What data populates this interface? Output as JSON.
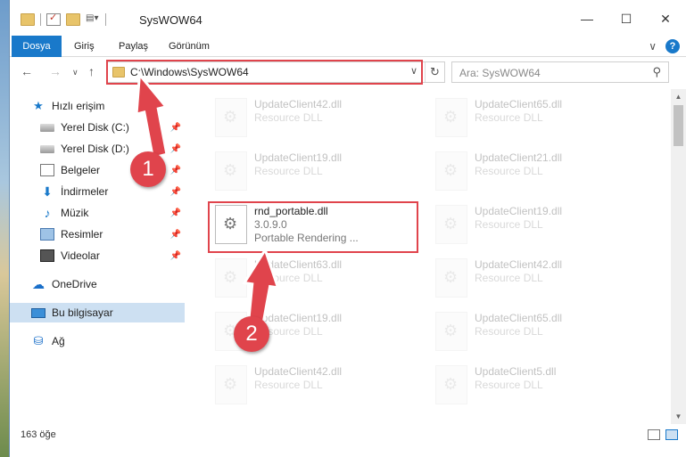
{
  "window": {
    "title": "SysWOW64",
    "minimize_icon": "—",
    "maximize_icon": "☐",
    "close_icon": "✕"
  },
  "ribbon": {
    "tabs": [
      "Dosya",
      "Giriş",
      "Paylaş",
      "Görünüm"
    ],
    "file_tab_color": "#1979ca",
    "collapse_icon": "∨",
    "help_icon": "?"
  },
  "navigation": {
    "back_icon": "←",
    "forward_icon": "→",
    "recent_icon": "∨",
    "up_icon": "↑",
    "address": "C:\\Windows\\SysWOW64",
    "address_dropdown_icon": "∨",
    "refresh_icon": "↻",
    "search_placeholder": "Ara: SysWOW64",
    "search_icon": "⚲"
  },
  "sidebar": {
    "items": [
      {
        "label": "Hızlı erişim",
        "icon": "star-icon",
        "pinned": false
      },
      {
        "label": "Yerel Disk (C:)",
        "icon": "drive-icon",
        "pinned": true
      },
      {
        "label": "Yerel Disk (D:)",
        "icon": "drive-icon",
        "pinned": true
      },
      {
        "label": "Belgeler",
        "icon": "documents-icon",
        "pinned": true
      },
      {
        "label": "İndirmeler",
        "icon": "downloads-icon",
        "pinned": true
      },
      {
        "label": "Müzik",
        "icon": "music-icon",
        "pinned": true
      },
      {
        "label": "Resimler",
        "icon": "pictures-icon",
        "pinned": true
      },
      {
        "label": "Videolar",
        "icon": "videos-icon",
        "pinned": true
      },
      {
        "label": "OneDrive",
        "icon": "onedrive-icon",
        "pinned": false
      },
      {
        "label": "Bu bilgisayar",
        "icon": "this-pc-icon",
        "pinned": false,
        "selected": true
      },
      {
        "label": "Ağ",
        "icon": "network-icon",
        "pinned": false
      }
    ],
    "pin_icon": "📌"
  },
  "files": [
    {
      "name": "UpdateClient42.dll",
      "line2": "Resource DLL",
      "line3": "",
      "faded": true
    },
    {
      "name": "UpdateClient65.dll",
      "line2": "Resource DLL",
      "line3": "",
      "faded": true
    },
    {
      "name": "UpdateClient19.dll",
      "line2": "Resource DLL",
      "line3": "",
      "faded": true
    },
    {
      "name": "UpdateClient21.dll",
      "line2": "Resource DLL",
      "line3": "",
      "faded": true
    },
    {
      "name": "rnd_portable.dll",
      "line2": "3.0.9.0",
      "line3": "Portable Rendering ...",
      "faded": false
    },
    {
      "name": "UpdateClient19.dll",
      "line2": "Resource DLL",
      "line3": "",
      "faded": true
    },
    {
      "name": "UpdateClient63.dll",
      "line2": "Resource DLL",
      "line3": "",
      "faded": true
    },
    {
      "name": "UpdateClient42.dll",
      "line2": "Resource DLL",
      "line3": "",
      "faded": true
    },
    {
      "name": "UpdateClient19.dll",
      "line2": "Resource DLL",
      "line3": "",
      "faded": true
    },
    {
      "name": "UpdateClient65.dll",
      "line2": "Resource DLL",
      "line3": "",
      "faded": true
    },
    {
      "name": "UpdateClient42.dll",
      "line2": "Resource DLL",
      "line3": "",
      "faded": true
    },
    {
      "name": "UpdateClient5.dll",
      "line2": "Resource DLL",
      "line3": "",
      "faded": true
    }
  ],
  "status": {
    "item_count": "163 öğe"
  },
  "callouts": {
    "step1": "1",
    "step2": "2",
    "accent": "#e0444c"
  }
}
